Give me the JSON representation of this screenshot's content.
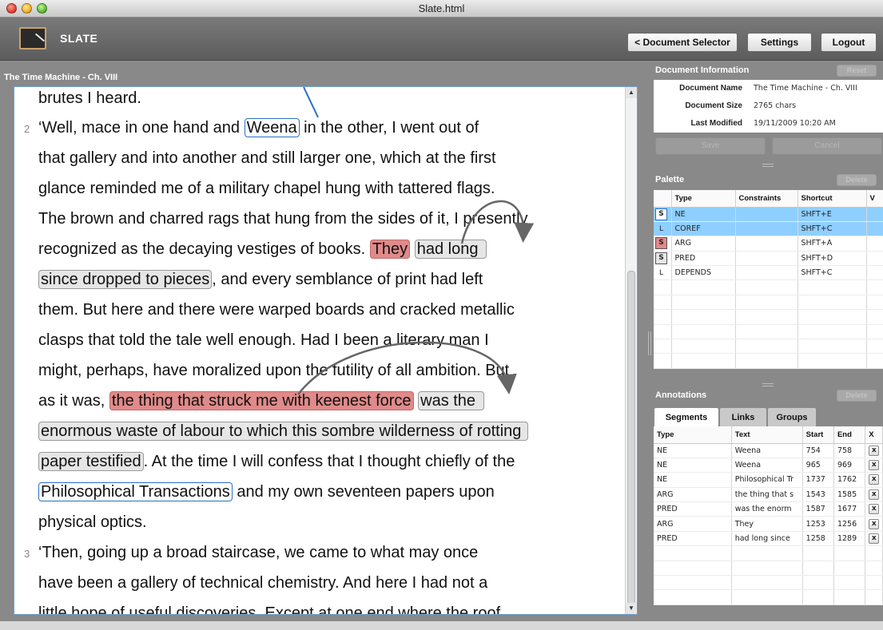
{
  "window": {
    "title": "Slate.html"
  },
  "header": {
    "app_name": "SLATE",
    "buttons": {
      "document_selector": "< Document Selector",
      "settings": "Settings",
      "logout": "Logout"
    }
  },
  "document": {
    "title": "The Time Machine - Ch. VIII",
    "paragraph_numbers": {
      "p2": "2",
      "p3": "3"
    },
    "lines": {
      "l1": "brutes I heard.",
      "l2a": "‘Well, mace in one hand and ",
      "l2b": "Weena",
      "l2c": " in the other, I went out of",
      "l3": "that gallery and into another and still larger one, which at the first",
      "l4": "glance reminded me of a military chapel hung with tattered flags.",
      "l5": "The brown and charred rags that hung from the sides of it, I presently",
      "l6a": " recognized as the decaying vestiges of books. ",
      "l6b": "They",
      "l6c": "had long",
      "l7a": "since dropped to pieces",
      "l7b": ", and every semblance of print had left",
      "l8": "them. But here and there were warped boards and cracked metallic",
      "l9": "clasps that told the tale well enough. Had I been a literary man I",
      "l10": "might, perhaps, have moralized upon the futility of all ambition. But",
      "l11a": "as it was, ",
      "l11b": "the thing that struck me with keenest force",
      "l11c": "was the",
      "l12": "enormous waste of labour to which this sombre wilderness of rotting",
      "l13a": "paper testified",
      "l13b": ". At the time I will confess that I thought chiefly of the",
      "l14a": "Philosophical Transactions",
      "l14b": " and my own seventeen papers upon",
      "l15": "physical optics.",
      "l16": "‘Then, going up a broad staircase, we came to what may once",
      "l17": "have been a gallery of technical chemistry. And here I had not a",
      "l18": "little hope of useful discoveries. Except at one end where the roof"
    }
  },
  "doc_info": {
    "title": "Document Information",
    "reset_label": "Reset",
    "rows": [
      {
        "key": "Document Name",
        "value": "The Time Machine - Ch. VIII"
      },
      {
        "key": "Document Size",
        "value": "2765 chars"
      },
      {
        "key": "Last Modified",
        "value": "19/11/2009 10:20 AM"
      }
    ],
    "save_label": "Save",
    "cancel_label": "Cancel"
  },
  "palette": {
    "title": "Palette",
    "delete_label": "Delete",
    "columns": [
      "Type",
      "Constraints",
      "Shortcut",
      "V"
    ],
    "rows": [
      {
        "kind": "S",
        "type": "NE",
        "constraints": "",
        "shortcut": "SHFT+E"
      },
      {
        "kind": "L",
        "type": "COREF",
        "constraints": "",
        "shortcut": "SHFT+C"
      },
      {
        "kind": "S",
        "type": "ARG",
        "constraints": "",
        "shortcut": "SHFT+A"
      },
      {
        "kind": "S",
        "type": "PRED",
        "constraints": "",
        "shortcut": "SHFT+D"
      },
      {
        "kind": "L",
        "type": "DEPENDS",
        "constraints": "",
        "shortcut": "SHFT+C"
      }
    ]
  },
  "annotations": {
    "title": "Annotations",
    "delete_label": "Delete",
    "tabs": [
      "Segments",
      "Links",
      "Groups"
    ],
    "columns": [
      "Type",
      "Text",
      "Start",
      "End",
      "X"
    ],
    "rows": [
      {
        "type": "NE",
        "text": "Weena",
        "start": "754",
        "end": "758"
      },
      {
        "type": "NE",
        "text": "Weena",
        "start": "965",
        "end": "969"
      },
      {
        "type": "NE",
        "text": "Philosophical Tr",
        "start": "1737",
        "end": "1762"
      },
      {
        "type": "ARG",
        "text": "the thing that s",
        "start": "1543",
        "end": "1585"
      },
      {
        "type": "PRED",
        "text": "was the enorm",
        "start": "1587",
        "end": "1677"
      },
      {
        "type": "ARG",
        "text": "They",
        "start": "1253",
        "end": "1256"
      },
      {
        "type": "PRED",
        "text": "had long since",
        "start": "1258",
        "end": "1289"
      }
    ],
    "delete_row_label": "x"
  },
  "colors": {
    "ne_border": "#2a6fc9",
    "arg_fill": "#e08a8a",
    "pred_fill": "#e6e6e6",
    "selected_row": "#8fcfff"
  }
}
